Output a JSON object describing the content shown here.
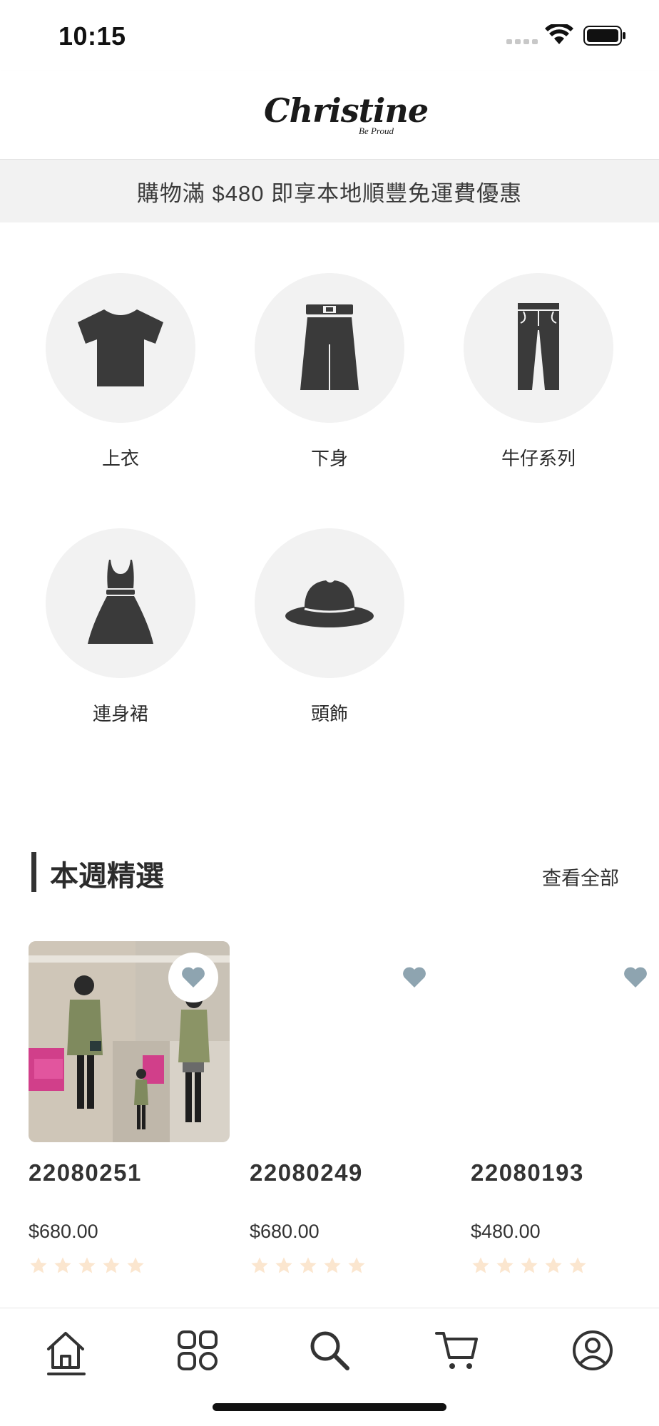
{
  "status_bar": {
    "time": "10:15"
  },
  "header": {
    "logo_text": "Christine",
    "logo_tagline": "Be Proud"
  },
  "promo": {
    "text": "購物滿 $480 即享本地順豐免運費優惠"
  },
  "categories": [
    {
      "label": "上衣",
      "icon": "tshirt-icon"
    },
    {
      "label": "下身",
      "icon": "skirt-icon"
    },
    {
      "label": "牛仔系列",
      "icon": "jeans-icon"
    },
    {
      "label": "連身裙",
      "icon": "dress-icon"
    },
    {
      "label": "頭飾",
      "icon": "hat-icon"
    }
  ],
  "section": {
    "title": "本週精選",
    "view_all": "查看全部"
  },
  "products": [
    {
      "id": "22080251",
      "price": "$680.00",
      "rating": 0
    },
    {
      "id": "22080249",
      "price": "$680.00",
      "rating": 0
    },
    {
      "id": "22080193",
      "price": "$480.00",
      "rating": 0
    }
  ],
  "colors": {
    "fav_heart": "#8ea4b0",
    "star_empty": "#fbe6cf",
    "icon_dark": "#3a3a3a",
    "circle_bg": "#f2f2f2"
  },
  "tabbar": {
    "items": [
      {
        "name": "home-icon",
        "active": true
      },
      {
        "name": "categories-icon",
        "active": false
      },
      {
        "name": "search-icon",
        "active": false
      },
      {
        "name": "cart-icon",
        "active": false
      },
      {
        "name": "account-icon",
        "active": false
      }
    ]
  }
}
